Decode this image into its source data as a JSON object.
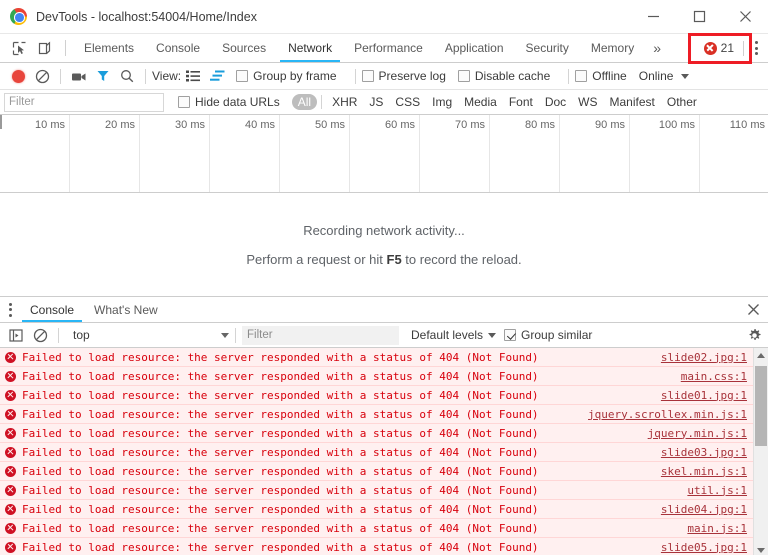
{
  "window": {
    "title": "DevTools - localhost:54004/Home/Index",
    "minimize_label": "Minimize",
    "maximize_label": "Maximize",
    "close_label": "Close",
    "logo_icon": "chrome-logo-icon"
  },
  "devtools": {
    "inspect_icon": "inspect-element-icon",
    "device_icon": "device-toolbar-icon",
    "tabs": [
      {
        "label": "Elements",
        "active": false
      },
      {
        "label": "Console",
        "active": false
      },
      {
        "label": "Sources",
        "active": false
      },
      {
        "label": "Network",
        "active": true
      },
      {
        "label": "Performance",
        "active": false
      },
      {
        "label": "Application",
        "active": false
      },
      {
        "label": "Security",
        "active": false
      },
      {
        "label": "Memory",
        "active": false
      }
    ],
    "more_tabs_label": "»",
    "error_count": "21",
    "error_icon": "error-circle-icon",
    "menu_icon": "kebab-menu-icon",
    "accent_color": "#29b6f6",
    "error_color": "#d93025",
    "annotation_color": "#ee1c25"
  },
  "network_toolbar": {
    "record_icon": "record-button-icon",
    "clear_icon": "clear-icon",
    "capture_screenshots_icon": "camera-icon",
    "filter_icon": "filter-funnel-icon",
    "search_icon": "search-icon",
    "view_label": "View:",
    "list_view_icon": "list-view-icon",
    "waterfall_view_icon": "waterfall-view-icon",
    "group_by_frame_label": "Group by frame",
    "group_by_frame_checked": false,
    "preserve_log_label": "Preserve log",
    "preserve_log_checked": false,
    "disable_cache_label": "Disable cache",
    "disable_cache_checked": false,
    "offline_label": "Offline",
    "offline_checked": false,
    "throttling_label": "Online",
    "throttling_caret_icon": "chevron-down-icon"
  },
  "filter_bar": {
    "filter_placeholder": "Filter",
    "filter_value": "",
    "hide_data_urls_label": "Hide data URLs",
    "hide_data_urls_checked": false,
    "types": [
      {
        "label": "All",
        "selected": true
      },
      {
        "label": "XHR",
        "selected": false
      },
      {
        "label": "JS",
        "selected": false
      },
      {
        "label": "CSS",
        "selected": false
      },
      {
        "label": "Img",
        "selected": false
      },
      {
        "label": "Media",
        "selected": false
      },
      {
        "label": "Font",
        "selected": false
      },
      {
        "label": "Doc",
        "selected": false
      },
      {
        "label": "WS",
        "selected": false
      },
      {
        "label": "Manifest",
        "selected": false
      },
      {
        "label": "Other",
        "selected": false
      }
    ]
  },
  "timeline": {
    "ticks": [
      "10 ms",
      "20 ms",
      "30 ms",
      "40 ms",
      "50 ms",
      "60 ms",
      "70 ms",
      "80 ms",
      "90 ms",
      "100 ms",
      "110 ms"
    ]
  },
  "empty_state": {
    "line1": "Recording network activity...",
    "line2_prefix": "Perform a request or hit ",
    "line2_key": "F5",
    "line2_suffix": " to record the reload."
  },
  "drawer": {
    "menu_icon": "kebab-menu-icon",
    "tabs": [
      {
        "label": "Console",
        "active": true
      },
      {
        "label": "What's New",
        "active": false
      }
    ],
    "close_icon": "close-icon"
  },
  "console_toolbar": {
    "sidebar_icon": "console-sidebar-icon",
    "clear_icon": "clear-console-icon",
    "context_value": "top",
    "context_caret_icon": "chevron-down-icon",
    "filter_placeholder": "Filter",
    "filter_value": "",
    "levels_label": "Default levels",
    "levels_caret_icon": "chevron-down-icon",
    "group_similar_label": "Group similar",
    "group_similar_checked": true,
    "settings_icon": "gear-icon"
  },
  "console_log": {
    "message": "Failed to load resource: the server responded with a status of 404 (Not Found)",
    "entries": [
      {
        "message": "Failed to load resource: the server responded with a status of 404 (Not Found)",
        "source": "slide02.jpg:1"
      },
      {
        "message": "Failed to load resource: the server responded with a status of 404 (Not Found)",
        "source": "main.css:1"
      },
      {
        "message": "Failed to load resource: the server responded with a status of 404 (Not Found)",
        "source": "slide01.jpg:1"
      },
      {
        "message": "Failed to load resource: the server responded with a status of 404 (Not Found)",
        "source": "jquery.scrollex.min.js:1"
      },
      {
        "message": "Failed to load resource: the server responded with a status of 404 (Not Found)",
        "source": "jquery.min.js:1"
      },
      {
        "message": "Failed to load resource: the server responded with a status of 404 (Not Found)",
        "source": "slide03.jpg:1"
      },
      {
        "message": "Failed to load resource: the server responded with a status of 404 (Not Found)",
        "source": "skel.min.js:1"
      },
      {
        "message": "Failed to load resource: the server responded with a status of 404 (Not Found)",
        "source": "util.js:1"
      },
      {
        "message": "Failed to load resource: the server responded with a status of 404 (Not Found)",
        "source": "slide04.jpg:1"
      },
      {
        "message": "Failed to load resource: the server responded with a status of 404 (Not Found)",
        "source": "main.js:1"
      },
      {
        "message": "Failed to load resource: the server responded with a status of 404 (Not Found)",
        "source": "slide05.jpg:1"
      }
    ],
    "scroll_up_icon": "scroll-up-arrow-icon",
    "scroll_down_icon": "scroll-down-arrow-icon"
  }
}
